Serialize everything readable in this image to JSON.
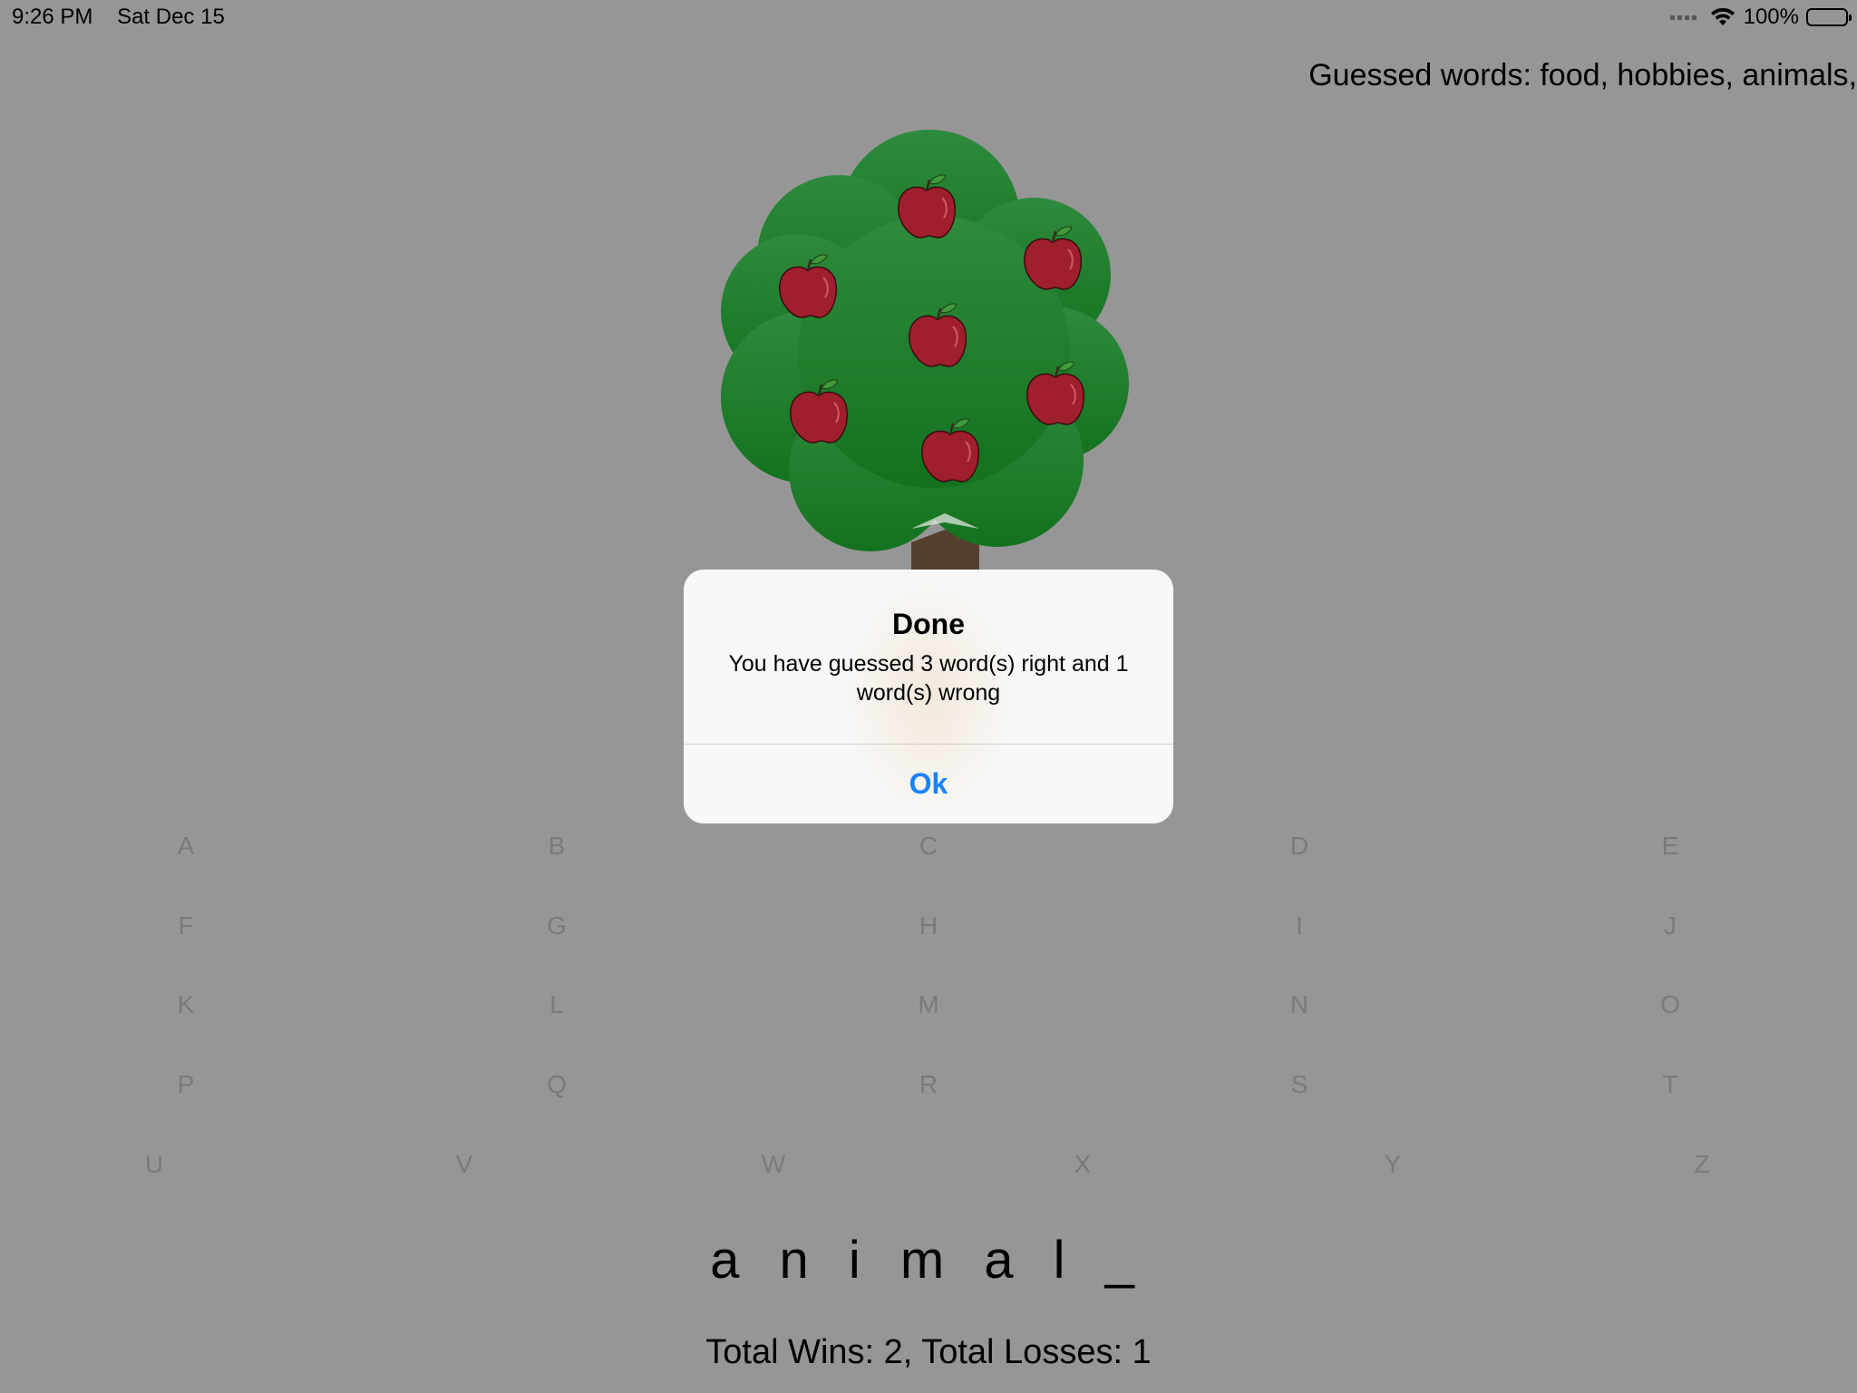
{
  "status_bar": {
    "time": "9:26 PM",
    "date": "Sat Dec 15",
    "battery": "100%",
    "icons": [
      "cellular-signal-icon",
      "wifi-icon",
      "battery-icon"
    ]
  },
  "game": {
    "guessed_words": "Guessed words: food, hobbies, animals,",
    "word_display": "a n i m a l _",
    "score": "Total Wins: 2, Total Losses: 1",
    "apples_remaining": 7,
    "letters": [
      "A",
      "B",
      "C",
      "D",
      "E",
      "F",
      "G",
      "H",
      "I",
      "J",
      "K",
      "L",
      "M",
      "N",
      "O",
      "P",
      "Q",
      "R",
      "S",
      "T",
      "U",
      "V",
      "W",
      "X",
      "Y",
      "Z"
    ]
  },
  "alert": {
    "title": "Done",
    "message": "You have guessed 3 word(s) right and 1 word(s) wrong",
    "button": "Ok"
  },
  "colors": {
    "background": "#969696",
    "foliage": "#1c7a27",
    "apple": "#a01f2d",
    "trunk": "#54402d",
    "alert_button": "#1a82fb"
  }
}
